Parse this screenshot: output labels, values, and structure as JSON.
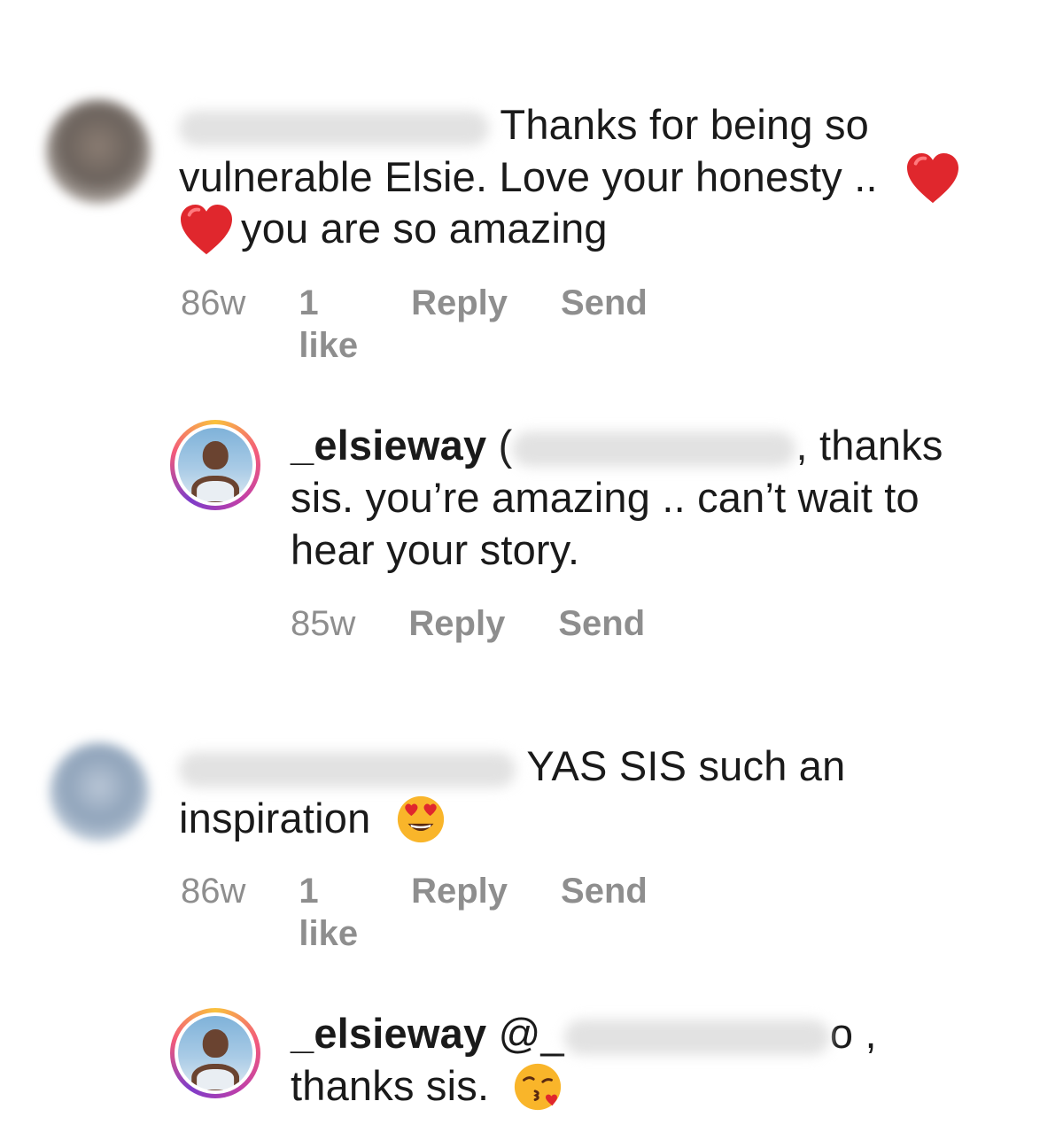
{
  "comments": [
    {
      "text_1": "Thanks for being so",
      "text_2": "vulnerable Elsie. Love your honesty ..",
      "text_3": "you are so amazing",
      "time": "86w",
      "likes": "1 like",
      "reply": "Reply",
      "send": "Send"
    },
    {
      "username": "_elsieway",
      "text_1": "(",
      "text_2": ", thanks",
      "text_3": "sis. you’re amazing .. can’t wait to",
      "text_4": "hear your story.",
      "time": "85w",
      "reply": "Reply",
      "send": "Send"
    },
    {
      "text_1": "YAS SIS such an",
      "text_2": "inspiration",
      "time": "86w",
      "likes": "1 like",
      "reply": "Reply",
      "send": "Send"
    },
    {
      "username": "_elsieway",
      "mention": "@_",
      "text_1": "o ,",
      "text_2": "thanks sis."
    }
  ],
  "colors": {
    "meta_gray": "#8e8e8e",
    "heart_red": "#e0272d",
    "emoji_yellow": "#f9b52a"
  },
  "icons": [
    "red-heart-icon",
    "heart-eyes-emoji-icon",
    "kissing-face-emoji-icon"
  ]
}
